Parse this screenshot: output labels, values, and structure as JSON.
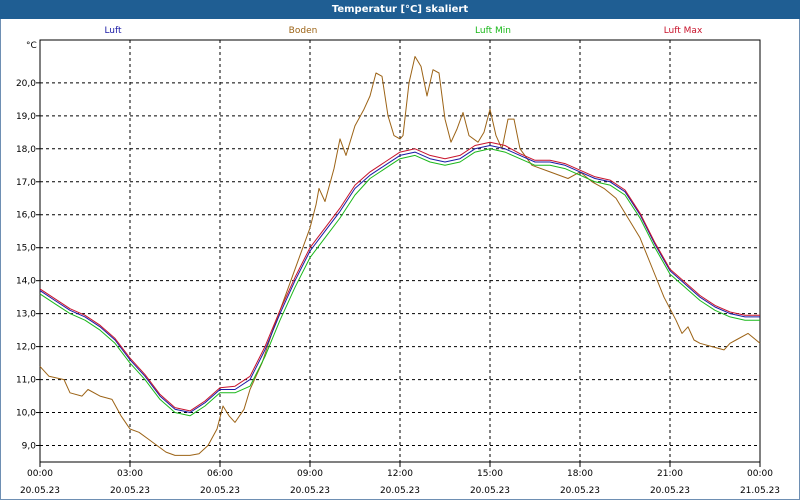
{
  "window": {
    "title": "Temperatur [°C] skaliert"
  },
  "chart_data": {
    "type": "line",
    "title": "Temperatur [°C] skaliert",
    "ylabel": "°C",
    "xlim": [
      0,
      24
    ],
    "ylim": [
      8.5,
      21.3
    ],
    "grid": true,
    "legend_position": "top",
    "y_ticks": [
      "9,0",
      "10,0",
      "11,0",
      "12,0",
      "13,0",
      "14,0",
      "15,0",
      "16,0",
      "17,0",
      "18,0",
      "19,0",
      "20,0"
    ],
    "x_ticks": [
      {
        "time": "00:00",
        "date": "20.05.23",
        "x": 0
      },
      {
        "time": "03:00",
        "date": "20.05.23",
        "x": 3
      },
      {
        "time": "06:00",
        "date": "20.05.23",
        "x": 6
      },
      {
        "time": "09:00",
        "date": "20.05.23",
        "x": 9
      },
      {
        "time": "12:00",
        "date": "20.05.23",
        "x": 12
      },
      {
        "time": "15:00",
        "date": "20.05.23",
        "x": 15
      },
      {
        "time": "18:00",
        "date": "20.05.23",
        "x": 18
      },
      {
        "time": "21:00",
        "date": "20.05.23",
        "x": 21
      },
      {
        "time": "00:00",
        "date": "21.05.23",
        "x": 24
      }
    ],
    "series": [
      {
        "name": "Luft",
        "color": "#1a1aa6",
        "points": [
          [
            0,
            13.7
          ],
          [
            0.5,
            13.4
          ],
          [
            1,
            13.1
          ],
          [
            1.5,
            12.9
          ],
          [
            2,
            12.6
          ],
          [
            2.5,
            12.2
          ],
          [
            3,
            11.6
          ],
          [
            3.5,
            11.1
          ],
          [
            4,
            10.5
          ],
          [
            4.5,
            10.1
          ],
          [
            5,
            10.0
          ],
          [
            5.5,
            10.3
          ],
          [
            6,
            10.7
          ],
          [
            6.5,
            10.7
          ],
          [
            7,
            11.0
          ],
          [
            7.5,
            11.9
          ],
          [
            8,
            13.0
          ],
          [
            8.5,
            14.0
          ],
          [
            9,
            14.9
          ],
          [
            9.5,
            15.5
          ],
          [
            10,
            16.1
          ],
          [
            10.5,
            16.8
          ],
          [
            11,
            17.2
          ],
          [
            11.5,
            17.5
          ],
          [
            12,
            17.8
          ],
          [
            12.5,
            17.9
          ],
          [
            13,
            17.7
          ],
          [
            13.5,
            17.6
          ],
          [
            14,
            17.7
          ],
          [
            14.5,
            18.0
          ],
          [
            15,
            18.1
          ],
          [
            15.5,
            18.0
          ],
          [
            16,
            17.8
          ],
          [
            16.5,
            17.6
          ],
          [
            17,
            17.6
          ],
          [
            17.5,
            17.5
          ],
          [
            18,
            17.3
          ],
          [
            18.5,
            17.1
          ],
          [
            19,
            17.0
          ],
          [
            19.5,
            16.7
          ],
          [
            20,
            16.0
          ],
          [
            20.5,
            15.1
          ],
          [
            21,
            14.3
          ],
          [
            21.5,
            13.9
          ],
          [
            22,
            13.5
          ],
          [
            22.5,
            13.2
          ],
          [
            23,
            13.0
          ],
          [
            23.5,
            12.9
          ],
          [
            24,
            12.9
          ]
        ]
      },
      {
        "name": "Boden",
        "color": "#9c6316",
        "points": [
          [
            0,
            11.4
          ],
          [
            0.3,
            11.1
          ],
          [
            0.8,
            11.0
          ],
          [
            1,
            10.6
          ],
          [
            1.4,
            10.5
          ],
          [
            1.6,
            10.7
          ],
          [
            2,
            10.5
          ],
          [
            2.4,
            10.4
          ],
          [
            2.7,
            9.9
          ],
          [
            3,
            9.5
          ],
          [
            3.3,
            9.4
          ],
          [
            3.6,
            9.2
          ],
          [
            3.9,
            9.0
          ],
          [
            4.2,
            8.8
          ],
          [
            4.5,
            8.7
          ],
          [
            5,
            8.7
          ],
          [
            5.3,
            8.75
          ],
          [
            5.6,
            9.0
          ],
          [
            5.9,
            9.5
          ],
          [
            6.1,
            10.2
          ],
          [
            6.3,
            9.9
          ],
          [
            6.5,
            9.7
          ],
          [
            6.8,
            10.1
          ],
          [
            7,
            10.7
          ],
          [
            7.4,
            11.5
          ],
          [
            7.8,
            12.6
          ],
          [
            8.2,
            13.6
          ],
          [
            8.6,
            14.6
          ],
          [
            9,
            15.6
          ],
          [
            9.2,
            16.3
          ],
          [
            9.3,
            16.8
          ],
          [
            9.5,
            16.4
          ],
          [
            9.8,
            17.4
          ],
          [
            10,
            18.3
          ],
          [
            10.2,
            17.8
          ],
          [
            10.5,
            18.7
          ],
          [
            10.8,
            19.2
          ],
          [
            11,
            19.6
          ],
          [
            11.2,
            20.3
          ],
          [
            11.4,
            20.2
          ],
          [
            11.6,
            19.0
          ],
          [
            11.8,
            18.4
          ],
          [
            12,
            18.3
          ],
          [
            12.1,
            18.4
          ],
          [
            12.3,
            20.0
          ],
          [
            12.5,
            20.8
          ],
          [
            12.7,
            20.5
          ],
          [
            12.9,
            19.6
          ],
          [
            13.1,
            20.4
          ],
          [
            13.3,
            20.3
          ],
          [
            13.5,
            18.9
          ],
          [
            13.7,
            18.2
          ],
          [
            13.9,
            18.6
          ],
          [
            14.1,
            19.1
          ],
          [
            14.3,
            18.4
          ],
          [
            14.6,
            18.2
          ],
          [
            14.8,
            18.5
          ],
          [
            15,
            19.2
          ],
          [
            15.2,
            18.4
          ],
          [
            15.4,
            18.0
          ],
          [
            15.6,
            18.9
          ],
          [
            15.8,
            18.9
          ],
          [
            16,
            18.0
          ],
          [
            16.4,
            17.5
          ],
          [
            17,
            17.3
          ],
          [
            17.6,
            17.1
          ],
          [
            18,
            17.3
          ],
          [
            18.4,
            17.0
          ],
          [
            18.8,
            16.8
          ],
          [
            19.2,
            16.5
          ],
          [
            19.6,
            15.9
          ],
          [
            20,
            15.3
          ],
          [
            20.4,
            14.4
          ],
          [
            20.8,
            13.5
          ],
          [
            21.2,
            12.8
          ],
          [
            21.4,
            12.4
          ],
          [
            21.6,
            12.6
          ],
          [
            21.8,
            12.2
          ],
          [
            22,
            12.1
          ],
          [
            22.4,
            12.0
          ],
          [
            22.8,
            11.9
          ],
          [
            23,
            12.1
          ],
          [
            23.2,
            12.2
          ],
          [
            23.6,
            12.4
          ],
          [
            24,
            12.1
          ]
        ]
      },
      {
        "name": "Luft Min",
        "color": "#1ab81a",
        "points": [
          [
            0,
            13.6
          ],
          [
            0.5,
            13.3
          ],
          [
            1,
            13.0
          ],
          [
            1.5,
            12.8
          ],
          [
            2,
            12.5
          ],
          [
            2.5,
            12.1
          ],
          [
            3,
            11.5
          ],
          [
            3.5,
            11.0
          ],
          [
            4,
            10.4
          ],
          [
            4.5,
            10.0
          ],
          [
            5,
            9.9
          ],
          [
            5.5,
            10.2
          ],
          [
            6,
            10.6
          ],
          [
            6.5,
            10.6
          ],
          [
            7,
            10.8
          ],
          [
            7.5,
            11.7
          ],
          [
            8,
            12.8
          ],
          [
            8.5,
            13.8
          ],
          [
            9,
            14.7
          ],
          [
            9.5,
            15.3
          ],
          [
            10,
            15.9
          ],
          [
            10.5,
            16.6
          ],
          [
            11,
            17.1
          ],
          [
            11.5,
            17.4
          ],
          [
            12,
            17.7
          ],
          [
            12.5,
            17.8
          ],
          [
            13,
            17.6
          ],
          [
            13.5,
            17.5
          ],
          [
            14,
            17.6
          ],
          [
            14.5,
            17.9
          ],
          [
            15,
            18.0
          ],
          [
            15.5,
            17.9
          ],
          [
            16,
            17.7
          ],
          [
            16.5,
            17.5
          ],
          [
            17,
            17.5
          ],
          [
            17.5,
            17.4
          ],
          [
            18,
            17.2
          ],
          [
            18.5,
            17.0
          ],
          [
            19,
            16.9
          ],
          [
            19.5,
            16.6
          ],
          [
            20,
            15.9
          ],
          [
            20.5,
            15.0
          ],
          [
            21,
            14.2
          ],
          [
            21.5,
            13.8
          ],
          [
            22,
            13.4
          ],
          [
            22.5,
            13.1
          ],
          [
            23,
            12.9
          ],
          [
            23.5,
            12.8
          ],
          [
            24,
            12.8
          ]
        ]
      },
      {
        "name": "Luft Max",
        "color": "#c8142c",
        "points": [
          [
            0,
            13.75
          ],
          [
            0.5,
            13.45
          ],
          [
            1,
            13.15
          ],
          [
            1.5,
            12.95
          ],
          [
            2,
            12.65
          ],
          [
            2.5,
            12.25
          ],
          [
            3,
            11.65
          ],
          [
            3.5,
            11.15
          ],
          [
            4,
            10.55
          ],
          [
            4.5,
            10.15
          ],
          [
            5,
            10.05
          ],
          [
            5.5,
            10.35
          ],
          [
            6,
            10.75
          ],
          [
            6.5,
            10.8
          ],
          [
            7,
            11.1
          ],
          [
            7.5,
            12.0
          ],
          [
            8,
            13.1
          ],
          [
            8.5,
            14.1
          ],
          [
            9,
            15.0
          ],
          [
            9.5,
            15.6
          ],
          [
            10,
            16.2
          ],
          [
            10.5,
            16.9
          ],
          [
            11,
            17.3
          ],
          [
            11.5,
            17.6
          ],
          [
            12,
            17.9
          ],
          [
            12.5,
            18.0
          ],
          [
            13,
            17.8
          ],
          [
            13.5,
            17.7
          ],
          [
            14,
            17.8
          ],
          [
            14.5,
            18.1
          ],
          [
            15,
            18.2
          ],
          [
            15.5,
            18.1
          ],
          [
            16,
            17.85
          ],
          [
            16.5,
            17.65
          ],
          [
            17,
            17.65
          ],
          [
            17.5,
            17.55
          ],
          [
            18,
            17.35
          ],
          [
            18.5,
            17.15
          ],
          [
            19,
            17.05
          ],
          [
            19.5,
            16.75
          ],
          [
            20,
            16.05
          ],
          [
            20.5,
            15.15
          ],
          [
            21,
            14.35
          ],
          [
            21.5,
            13.95
          ],
          [
            22,
            13.55
          ],
          [
            22.5,
            13.25
          ],
          [
            23,
            13.05
          ],
          [
            23.5,
            12.95
          ],
          [
            24,
            12.95
          ]
        ]
      }
    ]
  }
}
